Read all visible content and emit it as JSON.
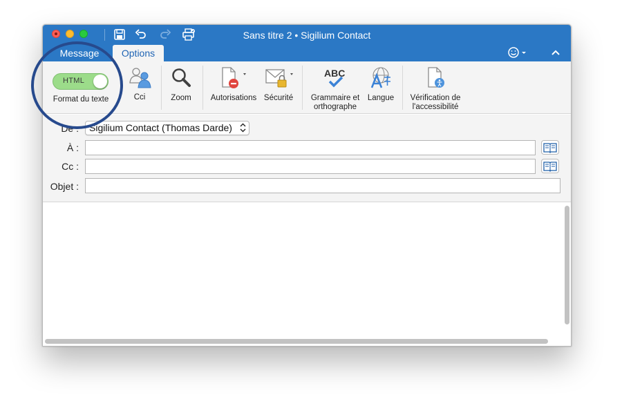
{
  "window": {
    "title": "Sans titre 2 • Sigilium Contact"
  },
  "quick_access": {
    "icons": [
      "save-icon",
      "undo-icon",
      "redo-icon",
      "print-icon"
    ]
  },
  "tabs": [
    {
      "label": "Message",
      "selected": false
    },
    {
      "label": "Options",
      "selected": true
    }
  ],
  "ribbon": {
    "format_toggle": {
      "value": "HTML",
      "label": "Format du texte",
      "state": "on"
    },
    "cci_label": "Cci",
    "zoom_label": "Zoom",
    "permissions_label": "Autorisations",
    "security_label": "Sécurité",
    "spelling_label_line1": "Grammaire et",
    "spelling_label_line2": "orthographe",
    "spelling_icon_text": "ABC",
    "language_label": "Langue",
    "accessibility_label_line1": "Vérification de",
    "accessibility_label_line2": "l'accessibilité"
  },
  "fields": {
    "from_label": "De :",
    "from_value": "Sigilium Contact (Thomas Darde)",
    "to_label": "À :",
    "to_value": "",
    "cc_label": "Cc :",
    "cc_value": "",
    "subject_label": "Objet :",
    "subject_value": ""
  },
  "colors": {
    "titlebar": "#2b78c5",
    "ribbon": "#f4f4f4",
    "toggle_on": "#9cdc8a",
    "highlight_ring": "#274a8d"
  }
}
